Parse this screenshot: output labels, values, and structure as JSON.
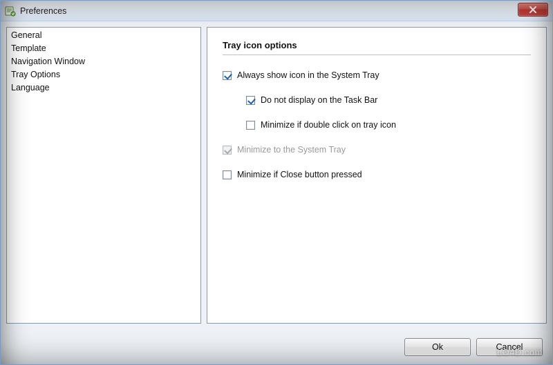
{
  "window": {
    "title": "Preferences"
  },
  "sidebar": {
    "items": [
      {
        "label": "General"
      },
      {
        "label": "Template"
      },
      {
        "label": "Navigation Window"
      },
      {
        "label": "Tray Options"
      },
      {
        "label": "Language"
      }
    ]
  },
  "section": {
    "title": "Tray icon options"
  },
  "options": {
    "always_show": {
      "label": "Always show icon in the System Tray",
      "checked": true,
      "disabled": false
    },
    "no_taskbar": {
      "label": "Do not display on the Task Bar",
      "checked": true,
      "disabled": false
    },
    "min_dblclick": {
      "label": "Minimize if double click on tray icon",
      "checked": false,
      "disabled": false
    },
    "min_to_tray": {
      "label": "Minimize to the System Tray",
      "checked": true,
      "disabled": true
    },
    "min_on_close": {
      "label": "Minimize if Close button pressed",
      "checked": false,
      "disabled": false
    }
  },
  "buttons": {
    "ok": "Ok",
    "cancel": "Cancel"
  },
  "watermark": "LO4D.com"
}
